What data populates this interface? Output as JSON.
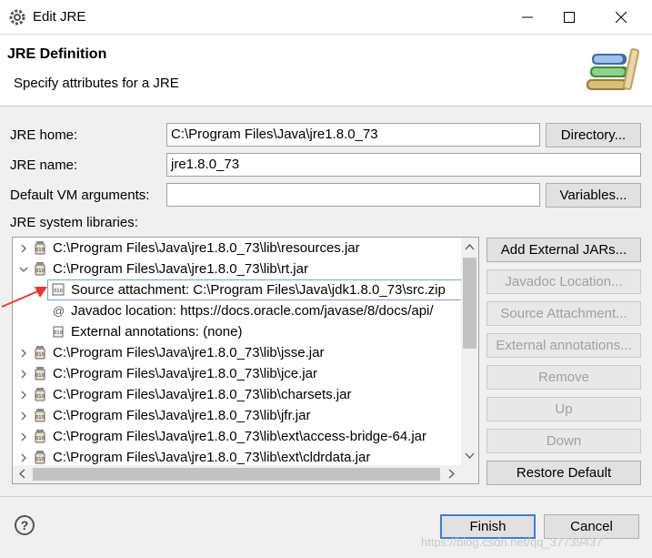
{
  "window": {
    "title": "Edit JRE",
    "icon": "gear-icon"
  },
  "header": {
    "title": "JRE Definition",
    "description": "Specify attributes for a JRE"
  },
  "form": {
    "jre_home_label": "JRE home:",
    "jre_home_value": "C:\\Program Files\\Java\\jre1.8.0_73",
    "directory_button": "Directory...",
    "jre_name_label": "JRE name:",
    "jre_name_value": "jre1.8.0_73",
    "vm_args_label": "Default VM arguments:",
    "vm_args_value": "",
    "variables_button": "Variables...",
    "libraries_label": "JRE system libraries:"
  },
  "tree": {
    "rows": [
      "C:\\Program Files\\Java\\jre1.8.0_73\\lib\\resources.jar",
      "C:\\Program Files\\Java\\jre1.8.0_73\\lib\\rt.jar",
      "Source attachment: C:\\Program Files\\Java\\jdk1.8.0_73\\src.zip",
      "Javadoc location: https://docs.oracle.com/javase/8/docs/api/",
      "External annotations: (none)",
      "C:\\Program Files\\Java\\jre1.8.0_73\\lib\\jsse.jar",
      "C:\\Program Files\\Java\\jre1.8.0_73\\lib\\jce.jar",
      "C:\\Program Files\\Java\\jre1.8.0_73\\lib\\charsets.jar",
      "C:\\Program Files\\Java\\jre1.8.0_73\\lib\\jfr.jar",
      "C:\\Program Files\\Java\\jre1.8.0_73\\lib\\ext\\access-bridge-64.jar",
      "C:\\Program Files\\Java\\jre1.8.0_73\\lib\\ext\\cldrdata.jar"
    ]
  },
  "side_buttons": {
    "add_external_jars": "Add External JARs...",
    "javadoc_location": "Javadoc Location...",
    "source_attachment": "Source Attachment...",
    "external_annotations": "External annotations...",
    "remove": "Remove",
    "up": "Up",
    "down": "Down",
    "restore_default": "Restore Default"
  },
  "footer": {
    "finish": "Finish",
    "cancel": "Cancel",
    "help_glyph": "?",
    "watermark": "https://blog.csdn.net/qq_37739437"
  },
  "colors": {
    "accent": "#3c7fd1",
    "arrow": "#e53935",
    "disabled_text": "#a0a0a0"
  }
}
